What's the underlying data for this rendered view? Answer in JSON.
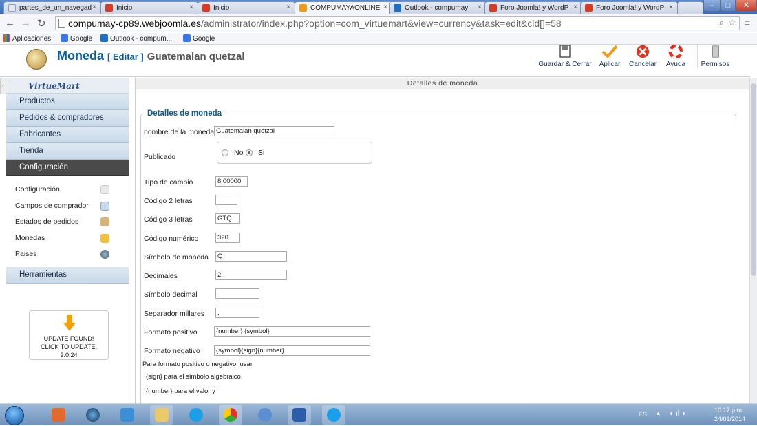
{
  "browser": {
    "tabs": [
      {
        "label": "partes_de_un_navegad",
        "icon_color": "#c8d4e6",
        "active": false
      },
      {
        "label": "Inicio",
        "icon_color": "#d93a21",
        "active": false
      },
      {
        "label": "Inicio",
        "icon_color": "#d93a21",
        "active": false
      },
      {
        "label": "COMPUMAYAONLINE",
        "icon_color": "#f39c12",
        "active": true
      },
      {
        "label": "Outlook - compumay",
        "icon_color": "#1e6fc2",
        "active": false
      },
      {
        "label": "Foro Joomla! y WordP",
        "icon_color": "#d93a21",
        "active": false
      },
      {
        "label": "Foro Joomla! y WordP",
        "icon_color": "#d93a21",
        "active": false
      }
    ],
    "tab_close": "×",
    "url_domain": "compumay-cp89.webjoomla.es",
    "url_path": "/administrator/index.php?option=com_virtuemart&view=currency&task=edit&cid[]=58",
    "bookmarks": [
      "Aplicaciones",
      "Google",
      "Outlook - compum...",
      "Google"
    ]
  },
  "header": {
    "title": "Moneda",
    "edit": "[ Editar ]",
    "item": "Guatemalan quetzal",
    "toolbar": [
      {
        "label": "Guardar & Cerrar",
        "icon": "save-icon"
      },
      {
        "label": "Aplicar",
        "icon": "check-icon"
      },
      {
        "label": "Cancelar",
        "icon": "cancel-icon"
      },
      {
        "label": "Ayuda",
        "icon": "help-icon"
      },
      {
        "label": "Permisos",
        "icon": "permissions-icon"
      }
    ]
  },
  "sidebar": {
    "logo": "VirtueMart",
    "menu": [
      "Productos",
      "Pedidos & compradores",
      "Fabricantes",
      "Tienda",
      "Configuración"
    ],
    "submenu": [
      "Configuración",
      "Campos de comprador",
      "Estados de pedidos",
      "Monedas",
      "Paises"
    ],
    "tools": "Herramientas",
    "update": {
      "line1": "UPDATE FOUND!",
      "line2": "CLICK TO UPDATE.",
      "version": "2.0.24"
    }
  },
  "content": {
    "section_header": "Detalles de moneda",
    "legend": "Detalles de moneda",
    "fields": {
      "name": {
        "label": "nombre de la moneda",
        "value": "Guatemalan quetzal"
      },
      "published": {
        "label": "Publicado",
        "no": "No",
        "yes": "Si",
        "selected": "Si"
      },
      "exchange": {
        "label": "Tipo de cambio",
        "value": "8.00000"
      },
      "code2": {
        "label": "Código 2 letras",
        "value": ""
      },
      "code3": {
        "label": "Código 3 letras",
        "value": "GTQ"
      },
      "numeric": {
        "label": "Código numérico",
        "value": "320"
      },
      "symbol": {
        "label": "Símbolo de moneda",
        "value": "Q"
      },
      "decimals": {
        "label": "Decimales",
        "value": "2"
      },
      "decimal_symbol": {
        "label": "Símbolo decimal",
        "value": "."
      },
      "thousands": {
        "label": "Separador millares",
        "value": ","
      },
      "positive": {
        "label": "Formato positivo",
        "value": "{number} {symbol}"
      },
      "negative": {
        "label": "Formato negativo",
        "value": "{symbol}{sign}{number}"
      }
    },
    "notes": [
      "Para formato positivo o negativo, usar",
      "{sign} para el símbolo algebraico,",
      "{number} para el valor y"
    ]
  },
  "taskbar": {
    "lang": "ES",
    "time": "10:17 p.m.",
    "date": "24/01/2014"
  }
}
